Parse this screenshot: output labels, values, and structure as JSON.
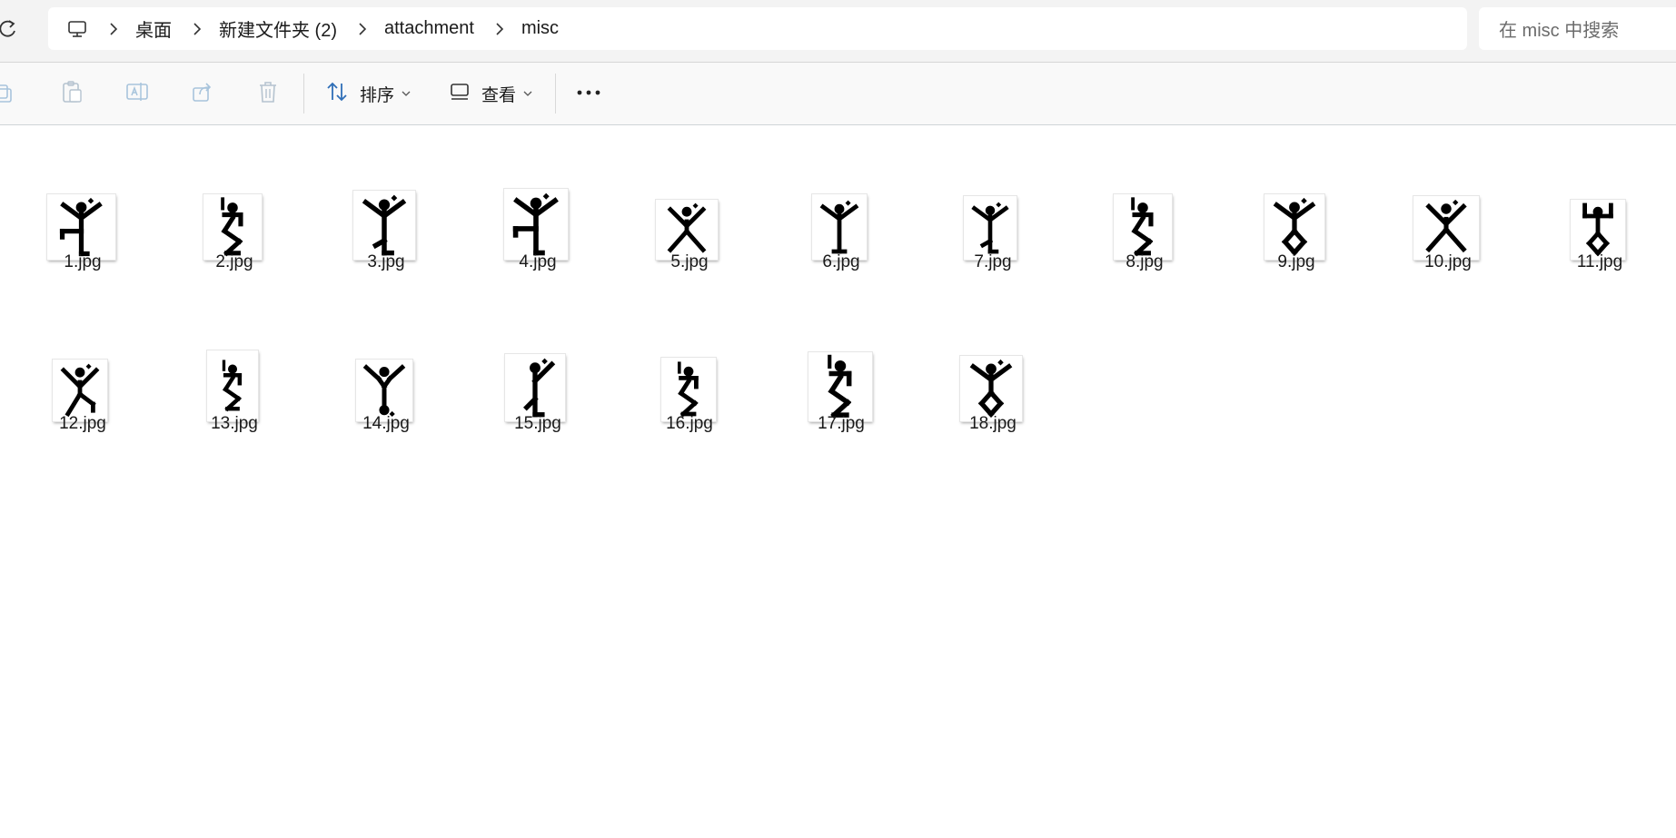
{
  "breadcrumb": {
    "items": [
      "桌面",
      "新建文件夹 (2)",
      "attachment",
      "misc"
    ]
  },
  "search": {
    "placeholder": "在 misc 中搜索"
  },
  "toolbar": {
    "sort_label": "排序",
    "view_label": "查看"
  },
  "files": [
    {
      "name": "1.jpg"
    },
    {
      "name": "2.jpg"
    },
    {
      "name": "3.jpg"
    },
    {
      "name": "4.jpg"
    },
    {
      "name": "5.jpg"
    },
    {
      "name": "6.jpg"
    },
    {
      "name": "7.jpg"
    },
    {
      "name": "8.jpg"
    },
    {
      "name": "9.jpg"
    },
    {
      "name": "10.jpg"
    },
    {
      "name": "11.jpg"
    },
    {
      "name": "12.jpg"
    },
    {
      "name": "13.jpg"
    },
    {
      "name": "14.jpg"
    },
    {
      "name": "15.jpg"
    },
    {
      "name": "16.jpg"
    },
    {
      "name": "17.jpg"
    },
    {
      "name": "18.jpg"
    }
  ]
}
